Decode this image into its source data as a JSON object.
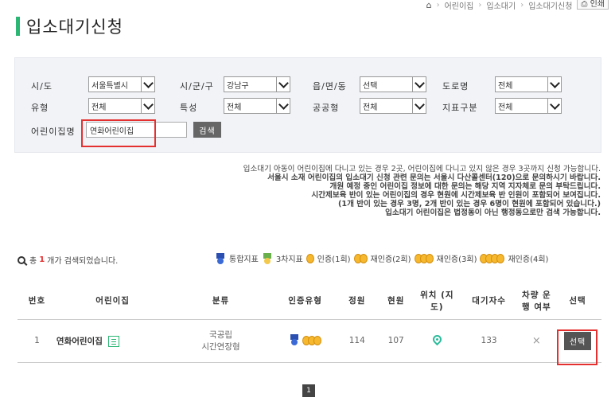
{
  "breadcrumb": {
    "home_icon": "home-icon",
    "items": [
      "어린이집",
      "입소대기",
      "입소대기신청"
    ],
    "print_label": "인쇄"
  },
  "page_title": "입소대기신청",
  "filters": {
    "sido_label": "시/도",
    "sido_value": "서울특별시",
    "sigungu_label": "시/군/구",
    "sigungu_value": "강남구",
    "eup_label": "읍/면/동",
    "eup_value": "선택",
    "road_label": "도로명",
    "road_value": "전체",
    "type_label": "유형",
    "type_value": "전체",
    "feature_label": "특성",
    "feature_value": "전체",
    "public_label": "공공형",
    "public_value": "전체",
    "index_label": "지표구분",
    "index_value": "전체",
    "name_label": "어린이집명",
    "name_value": "연화어린이집",
    "search_label": "검색"
  },
  "notice": [
    "입소대기 아동이 어린이집에 다니고 있는 경우 2곳, 어린이집에 다니고 있지 않은 경우 3곳까지 신청 가능합니다.",
    "서울시 소재 어린이집의 입소대기 신청 관련 문의는 서울시 다산콜센터(120)으로 문의하시기 바랍니다.",
    "개원 예정 중인 어린이집 정보에 대한 문의는 해당 지역 지자체로 문의 부탁드립니다.",
    "시간제보육 반이 있는 어린이집의 경우 현원에 시간제보육 반 인원이 포함되어 보여집니다.",
    "(1개 반이 있는 경우 3명, 2개 반이 있는 경우 6명이 현원에 포함되어 있습니다.)",
    "입소대기 어린이집은 법정동이 아닌 행정동으로만 검색 가능합니다."
  ],
  "result": {
    "prefix": "총",
    "count": "1",
    "suffix": "개가 검색되었습니다."
  },
  "legend": {
    "integrated": "통합지표",
    "third": "3차지표",
    "cert1": "인증(1회)",
    "cert2": "재인증(2회)",
    "cert3": "재인증(3회)",
    "cert4": "재인증(4회)"
  },
  "table": {
    "headers": {
      "no": "번호",
      "name": "어린이집",
      "category": "분류",
      "cert": "인증유형",
      "capacity": "정원",
      "current": "현원",
      "location": "위치 (지도)",
      "waiting": "대기자수",
      "vehicle": "차량 운행 여부",
      "select": "선택"
    },
    "rows": [
      {
        "no": "1",
        "name": "연화어린이집",
        "category_line1": "국공립",
        "category_line2": "시간연장형",
        "capacity": "114",
        "current": "107",
        "waiting": "133",
        "vehicle": "×",
        "select_label": "선택"
      }
    ]
  },
  "pagination": {
    "current": "1"
  },
  "colors": {
    "accent": "#2bb673",
    "highlight": "#e53030"
  }
}
